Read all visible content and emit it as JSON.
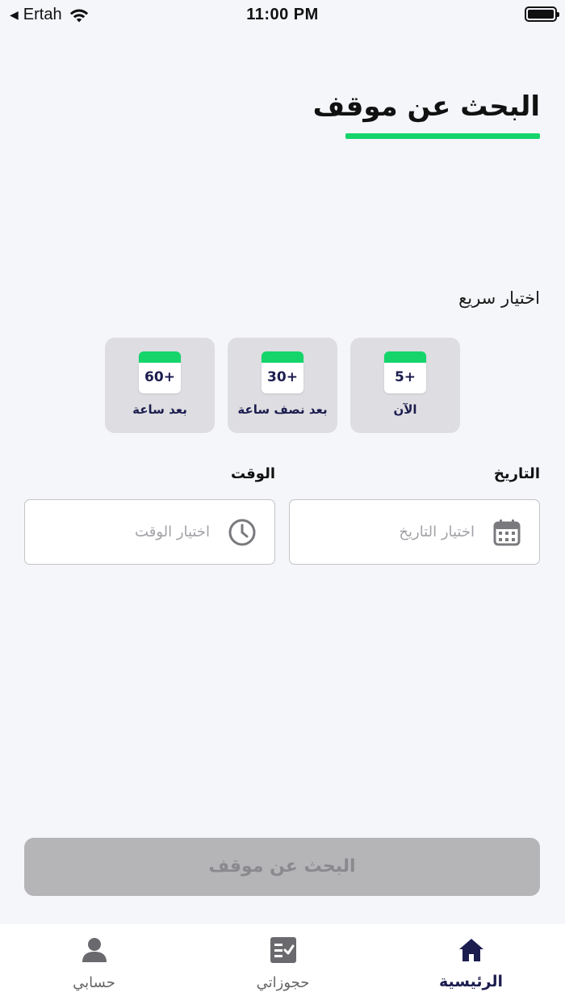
{
  "status_bar": {
    "back_arrow": "◀",
    "carrier": "Ertah",
    "time": "11:00 PM"
  },
  "header": {
    "title": "البحث عن موقف"
  },
  "quick_select": {
    "label": "اختيار سريع",
    "options": [
      {
        "value": "5+",
        "label": "الآن"
      },
      {
        "value": "30+",
        "label": "بعد نصف ساعة"
      },
      {
        "value": "60+",
        "label": "بعد ساعة"
      }
    ]
  },
  "date": {
    "label": "التاريخ",
    "placeholder": "اختيار التاريخ",
    "icon": "calendar-icon"
  },
  "time": {
    "label": "الوقت",
    "placeholder": "اختيار الوقت",
    "icon": "clock-icon"
  },
  "search_button": {
    "label": "البحث عن موقف"
  },
  "tabs": [
    {
      "label": "الرئيسية",
      "icon": "home-icon",
      "active": true
    },
    {
      "label": "حجوزاتي",
      "icon": "bookings-icon",
      "active": false
    },
    {
      "label": "حسابي",
      "icon": "user-icon",
      "active": false
    }
  ],
  "colors": {
    "accent": "#14d46a",
    "navy": "#1c1d4f",
    "background": "#f5f6fa",
    "disabled_button": "#b5b5b8"
  }
}
